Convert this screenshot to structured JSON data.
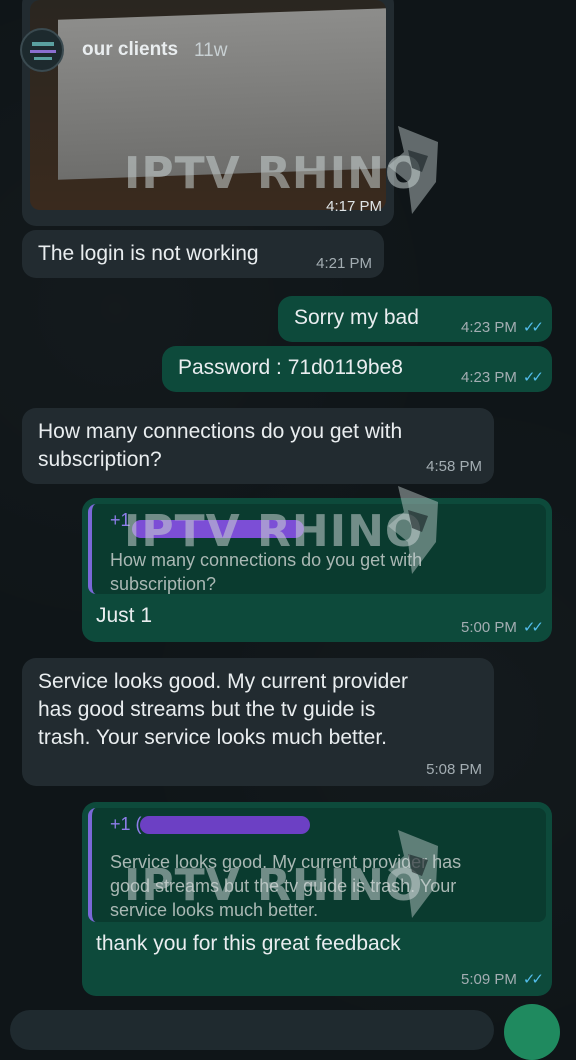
{
  "story": {
    "name": "our clients",
    "age": "11w"
  },
  "watermark": "IPTV RHINO",
  "messages": {
    "m0": {
      "time": "4:17 PM"
    },
    "m1": {
      "text": "The login is not working",
      "time": "4:21 PM"
    },
    "m2": {
      "text": "Sorry my bad",
      "time": "4:23 PM"
    },
    "m3": {
      "text": "Password : 71d0119be8",
      "time": "4:23 PM"
    },
    "m4": {
      "line1": "How many connections do you get with",
      "line2": "subscription?",
      "time": "4:58 PM"
    },
    "m5": {
      "quote_name": "+1",
      "quote_line1": "How many connections do you get with",
      "quote_line2": "subscription?",
      "text": "Just 1",
      "time": "5:00 PM"
    },
    "m6": {
      "line1": "Service looks good. My current provider",
      "line2": "has good streams but the tv guide is",
      "line3": "trash. Your service looks much better.",
      "time": "5:08 PM"
    },
    "m7": {
      "quote_name": "+1 (",
      "quote_line1": "Service looks good. My current provider has",
      "quote_line2": "good streams but the tv guide is trash. Your",
      "quote_line3": "service looks much better.",
      "text": "thank you for this great feedback",
      "time": "5:09 PM"
    }
  },
  "colors": {
    "incoming": "#222b30",
    "outgoing": "#0d4a3b",
    "read_tick": "#53bdeb",
    "quote_bar": "#7a68d8"
  }
}
